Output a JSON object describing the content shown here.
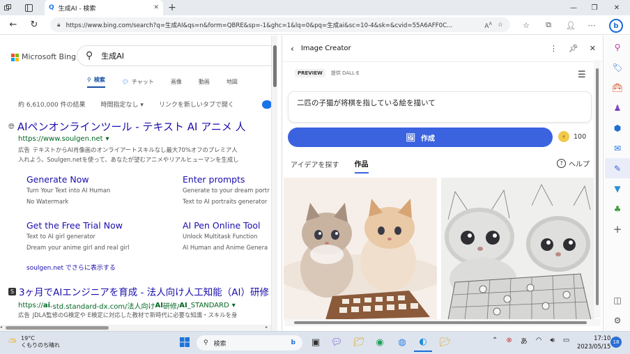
{
  "browser": {
    "tab_title": "生成AI - 検索",
    "tab_favicon": "search-icon",
    "new_tab": "+",
    "url": "https://www.bing.com/search?q=生成AI&qs=n&form=QBRE&sp=-1&ghc=1&lq=0&pq=生成ai&sc=10-4&sk=&cvid=55A6AFF0C..."
  },
  "bing": {
    "logo_text": "Microsoft Bing",
    "query": "生成AI",
    "scopes": [
      {
        "label": "検索",
        "icon": "search-icon",
        "active": true
      },
      {
        "label": "チャット",
        "icon": "chat-icon",
        "active": false
      },
      {
        "label": "画像",
        "active": false
      },
      {
        "label": "動画",
        "active": false
      },
      {
        "label": "地図",
        "active": false
      }
    ],
    "filters": {
      "count": "約 6,610,000 件の結果",
      "time": "時間指定なし ▾",
      "newtab": "リンクを新しいタブで開く"
    },
    "result1": {
      "title": "AIペンオンラインツール - テキスト AI アニメ 人",
      "url": "https://www.soulgen.net",
      "url_caret": "▾",
      "ad_label": "広告",
      "snippet1": "テキストからAI肖像画のオンライアートスキルなし最大70%オフのプレミア人",
      "snippet2": "入れよう。Soulgen.netを使って、あなたが望むアニメやリアルヒューマンを生成し",
      "sitelinks": [
        {
          "title": "Generate Now",
          "d1": "Turn Your Text into AI Human",
          "d2": "No Watermark"
        },
        {
          "title": "Enter prompts",
          "d1": "Generate to your dream portr",
          "d2": "Text to AI portraits generator"
        },
        {
          "title": "Get the Free Trial Now",
          "d1": "Text to AI girl generator",
          "d2": "Dream your anime girl and real girl"
        },
        {
          "title": "AI Pen Online Tool",
          "d1": "Unlock Multitask Function",
          "d2": "AI Human and Anime Genera"
        }
      ],
      "more": "soulgen.net でさらに表示する"
    },
    "result2": {
      "title": "3ヶ月でAIエンジニアを育成 - 法人向け人工知能（AI）研修",
      "url_pre": "https://",
      "url_b1": "ai",
      "url_mid": "-std.standard-dx.com/法人向け",
      "url_b2": "AI",
      "url_mid2": "研修/",
      "url_b3": "AI",
      "url_end": "_STANDARD",
      "url_caret": "▾",
      "ad_label": "広告",
      "snippet": "JDLA監修のG検定や E検定に対応した教材で新時代に必要な知識・スキルを身"
    }
  },
  "image_creator": {
    "title": "Image Creator",
    "preview_badge": "PREVIEW",
    "provider": "提供 DALL·E",
    "prompt": "二匹の子猫が将棋を指している絵を描いて",
    "create_label": "作成",
    "boost_count": "100",
    "tabs": [
      "アイデアを探す",
      "作品"
    ],
    "active_tab": "作品",
    "help": "ヘルプ"
  },
  "taskbar": {
    "temp": "19°C",
    "weather": "くもりのち晴れ",
    "search": "検索",
    "ime": "あ",
    "time": "17:10",
    "date": "2023/05/15",
    "notifications": "18"
  },
  "colors": {
    "accent": "#3b63e0",
    "link": "#1a0dab",
    "url_green": "#006621"
  }
}
